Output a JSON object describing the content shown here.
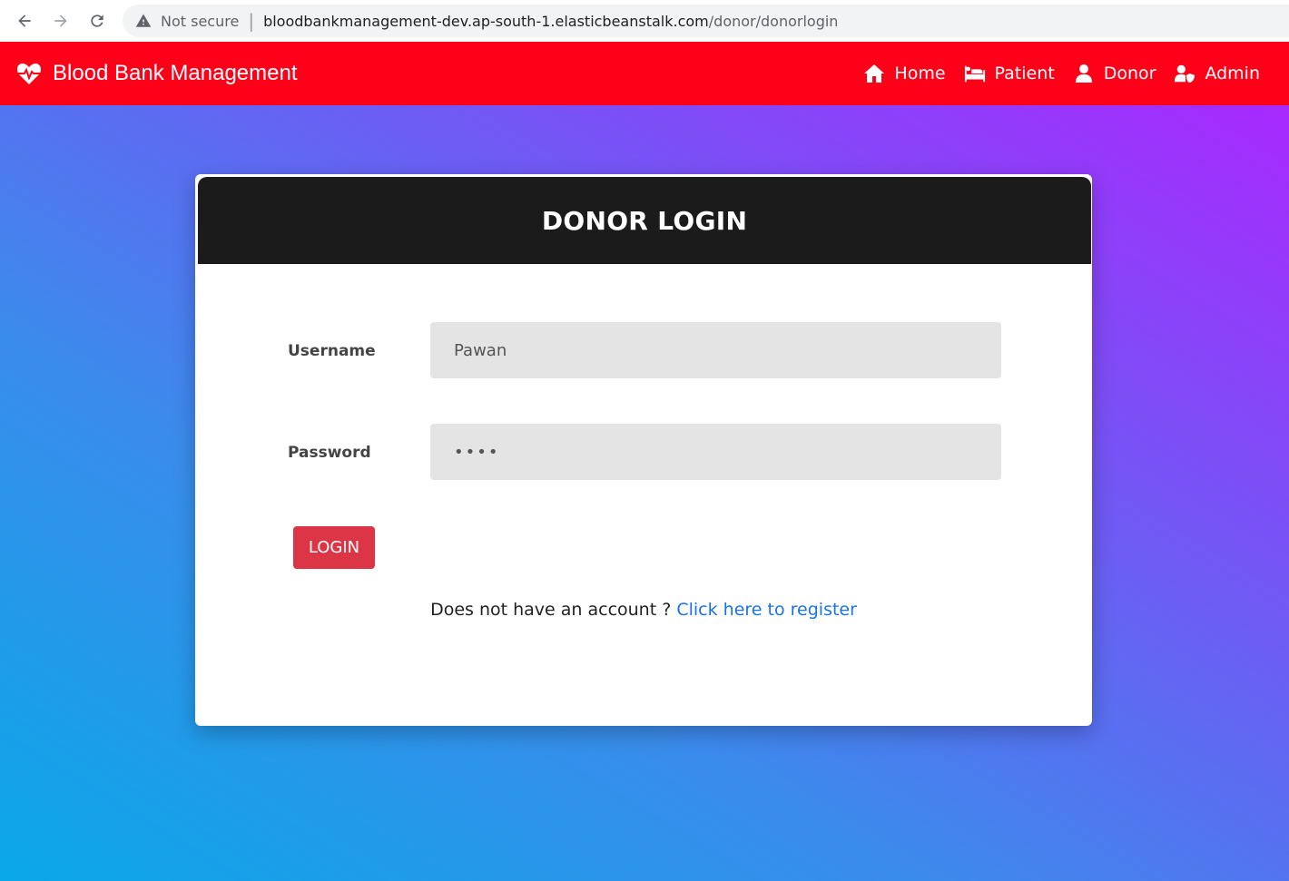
{
  "browser": {
    "security_label": "Not secure",
    "url_host": "bloodbankmanagement-dev.ap-south-1.elasticbeanstalk.com",
    "url_path": "/donor/donorlogin"
  },
  "navbar": {
    "brand": "Blood Bank Management",
    "links": [
      {
        "label": "Home",
        "icon": "home-icon"
      },
      {
        "label": "Patient",
        "icon": "bed-icon"
      },
      {
        "label": "Donor",
        "icon": "user-icon"
      },
      {
        "label": "Admin",
        "icon": "user-shield-icon"
      }
    ],
    "color": "#ff0019"
  },
  "login": {
    "title": "DONOR LOGIN",
    "username_label": "Username",
    "username_value": "Pawan",
    "password_label": "Password",
    "password_value": "••••",
    "button": "LOGIN",
    "register_prompt": "Does not have an account ?",
    "register_link": "Click here to register"
  }
}
